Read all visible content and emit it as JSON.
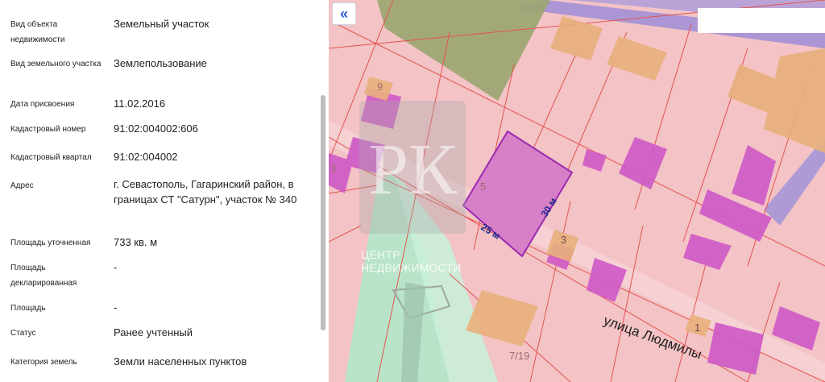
{
  "properties": [
    {
      "label": "Вид объекта недвижимости",
      "value": "Земельный участок"
    },
    {
      "label": "Вид земельного участка",
      "value": "Землепользование"
    },
    {
      "label": "Дата присвоения",
      "value": "11.02.2016"
    },
    {
      "label": "Кадастровый номер",
      "value": "91:02:004002:606"
    },
    {
      "label": "Кадастровый квартал",
      "value": "91:02:004002"
    },
    {
      "label": "Адрес",
      "value": "г. Севастополь, Гагаринский район, в границах СТ \"Сатурн\", участок № 340"
    },
    {
      "label": "Площадь уточненная",
      "value": "733 кв. м"
    },
    {
      "label": "Площадь декларированная",
      "value": "-"
    },
    {
      "label": "Площадь",
      "value": "-"
    },
    {
      "label": "Статус",
      "value": "Ранее учтенный"
    },
    {
      "label": "Категория земель",
      "value": "Земли населенных пунктов"
    }
  ],
  "map": {
    "collapse_icon": "double-chevron-left-icon",
    "collapse_glyph": "«",
    "street_label": "улица Людмилы",
    "dimension_side_a": "25 м",
    "dimension_side_b": "30 м",
    "parcel_numbers": [
      "9",
      "5",
      "3",
      "1",
      "7/19",
      "3"
    ],
    "watermark_logo": "РК",
    "watermark_text": "ЦЕНТР НЕДВИЖИМОСТИ",
    "colors": {
      "parcel_fill": "#f3c3c6",
      "parcel_border": "#e4534d",
      "selected_parcel": "#d77fc7",
      "building": "#cf59c7",
      "building_alt": "#e9b07b",
      "green_zone": "#b5e6c9",
      "olive_zone": "#9aa56f",
      "road_band": "#7777dd"
    }
  }
}
